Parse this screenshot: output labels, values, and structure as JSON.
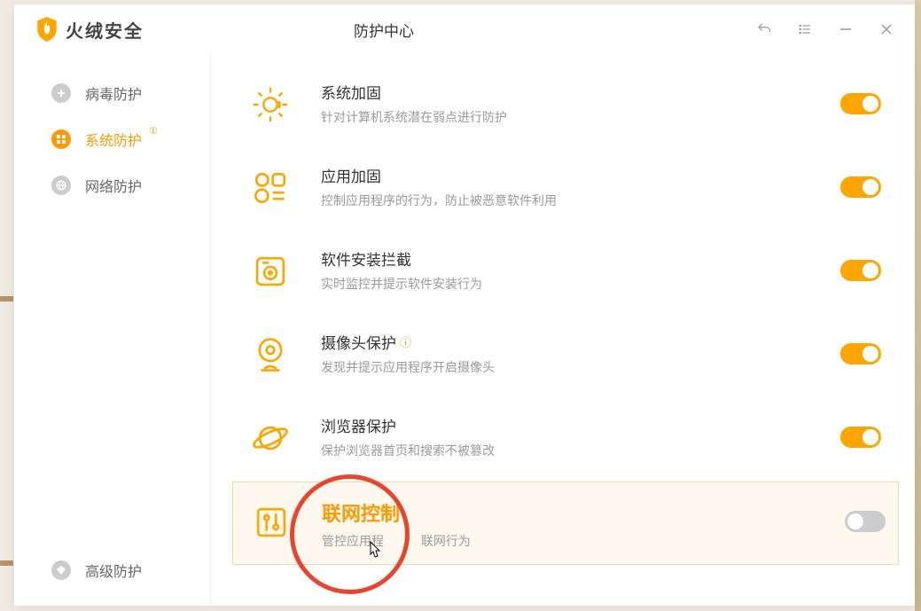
{
  "app": {
    "logo_text": "火绒安全"
  },
  "header": {
    "title": "防护中心"
  },
  "sidebar": {
    "items": [
      {
        "label": "病毒防护"
      },
      {
        "label": "系统防护"
      },
      {
        "label": "网络防护"
      }
    ],
    "bottom": {
      "label": "高级防护"
    }
  },
  "rows": [
    {
      "title": "系统加固",
      "desc": "针对计算机系统潜在弱点进行防护",
      "on": true
    },
    {
      "title": "应用加固",
      "desc": "控制应用程序的行为，防止被恶意软件利用",
      "on": true
    },
    {
      "title": "软件安装拦截",
      "desc": "实时监控并提示软件安装行为",
      "on": true
    },
    {
      "title": "摄像头保护",
      "desc": "发现并提示应用程序开启摄像头",
      "on": true,
      "info": true
    },
    {
      "title": "浏览器保护",
      "desc": "保护浏览器首页和搜索不被篡改",
      "on": true
    },
    {
      "title": "联网控制",
      "desc": "管控应用程序联网行为",
      "on": false,
      "highlighted": true,
      "truncated_desc": "管控应用程",
      "truncated_desc_tail": "联网行为"
    }
  ]
}
